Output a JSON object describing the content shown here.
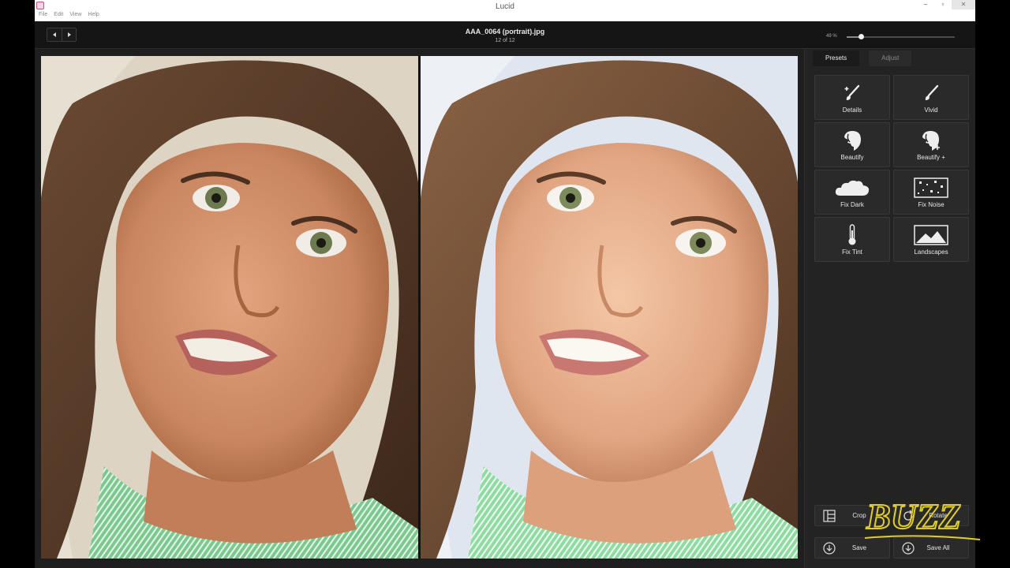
{
  "window": {
    "title": "Lucid",
    "menu": [
      "File",
      "Edit",
      "View",
      "Help"
    ],
    "controls": {
      "minimize": "–",
      "maximize": "▫",
      "close": "✕"
    }
  },
  "toolbar": {
    "file_name": "AAA_0064 (portrait).jpg",
    "file_count": "12 of 12",
    "zoom_label": "49 %",
    "zoom_fraction": 0.13
  },
  "panel": {
    "tabs": [
      {
        "label": "Presets",
        "active": true
      },
      {
        "label": "Adjust",
        "active": false
      }
    ],
    "presets": [
      {
        "label": "Details",
        "icon": "brush-plus-icon"
      },
      {
        "label": "Vivid",
        "icon": "brush-icon"
      },
      {
        "label": "Beautify",
        "icon": "face-icon"
      },
      {
        "label": "Beautify +",
        "icon": "face-plus-icon"
      },
      {
        "label": "Fix Dark",
        "icon": "cloud-icon"
      },
      {
        "label": "Fix Noise",
        "icon": "noise-icon"
      },
      {
        "label": "Fix Tint",
        "icon": "thermometer-icon"
      },
      {
        "label": "Landscapes",
        "icon": "landscape-icon"
      }
    ],
    "tools": {
      "crop_label": "Crop",
      "rotate_label": "Rotate",
      "save_label": "Save",
      "save_all_label": "Save All"
    }
  },
  "watermark_text": "BUZZ",
  "colors": {
    "app_bg": "#1f1f1f",
    "panel_bg": "#232323",
    "tile_bg": "#2a2a2a",
    "watermark": "#e0cd2a"
  }
}
